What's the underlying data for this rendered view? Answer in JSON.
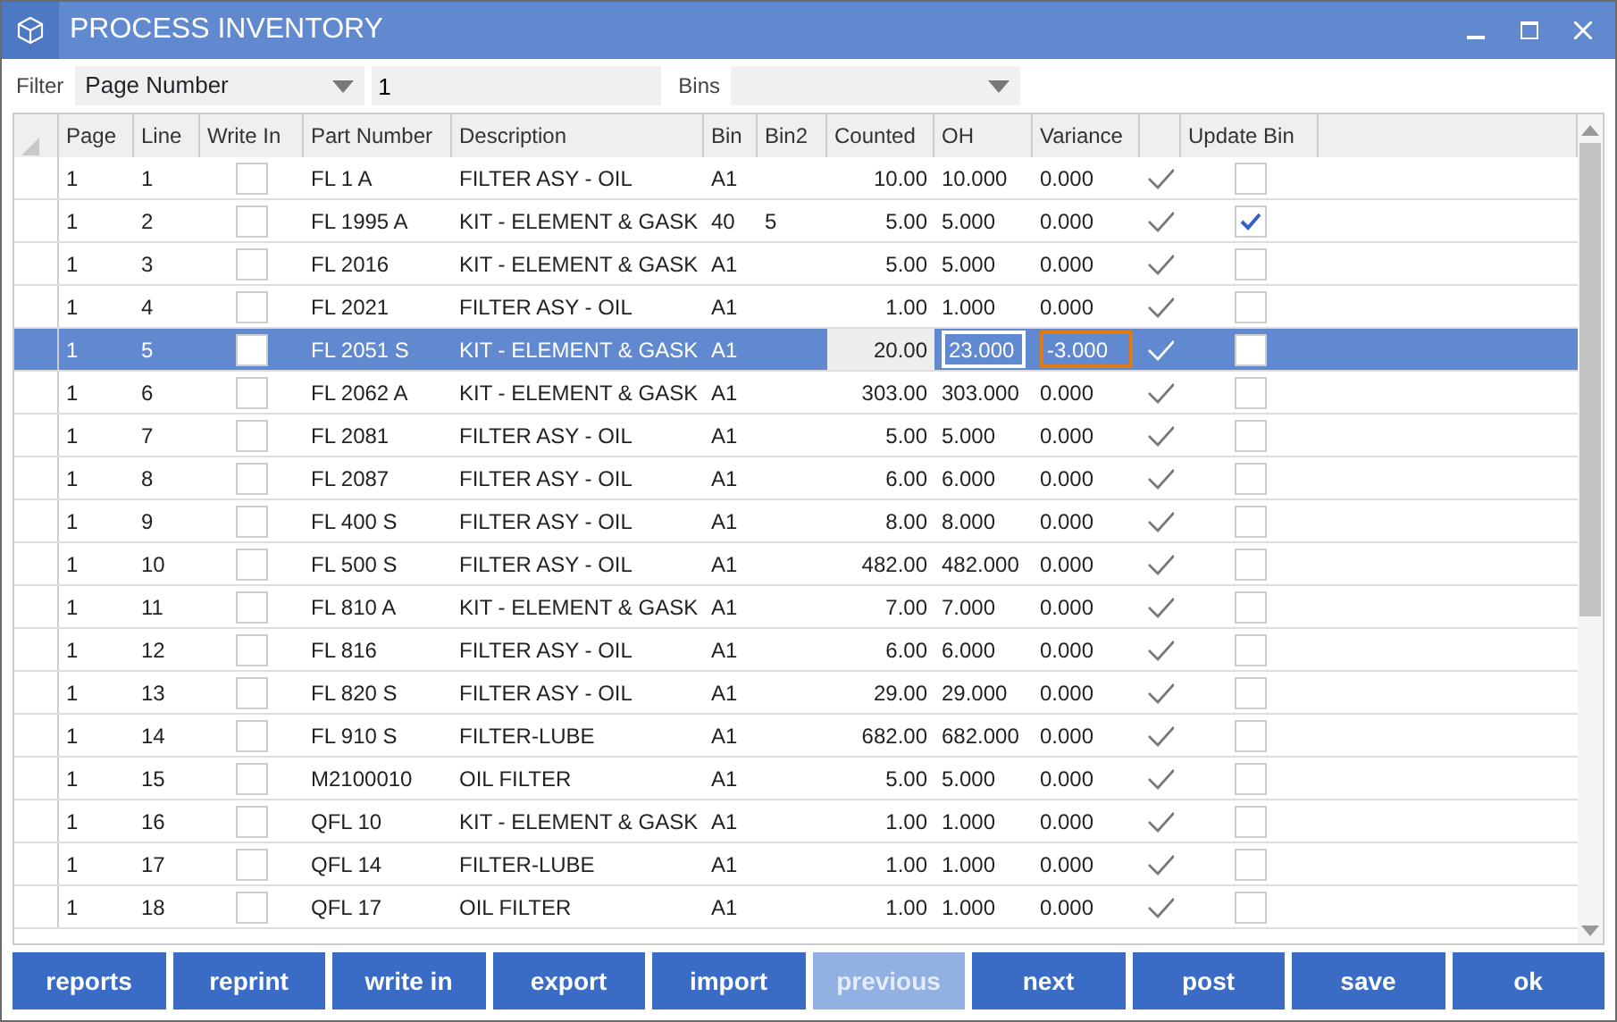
{
  "window": {
    "title": "PROCESS INVENTORY"
  },
  "filter": {
    "label": "Filter",
    "field": "Page Number",
    "value": "1",
    "bins_label": "Bins"
  },
  "table": {
    "columns": [
      "Page",
      "Line",
      "Write In",
      "Part Number",
      "Description",
      "Bin",
      "Bin2",
      "Counted",
      "OH",
      "Variance",
      "Update Bin"
    ],
    "rows": [
      {
        "page": "1",
        "line": "1",
        "write_in": false,
        "part": "FL 1 A",
        "description": "FILTER ASY - OIL",
        "bin": "A1",
        "counted": "10.00",
        "oh": "10.000",
        "variance": "0.000",
        "update_bin": false,
        "selected": false
      },
      {
        "page": "1",
        "line": "2",
        "write_in": false,
        "part": "FL 1995 A",
        "description": "KIT - ELEMENT & GASK",
        "bin": "40",
        "bin2": "5",
        "counted": "5.00",
        "oh": "5.000",
        "variance": "0.000",
        "update_bin": true,
        "selected": false
      },
      {
        "page": "1",
        "line": "3",
        "write_in": false,
        "part": "FL 2016",
        "description": "KIT - ELEMENT & GASK",
        "bin": "A1",
        "counted": "5.00",
        "oh": "5.000",
        "variance": "0.000",
        "update_bin": false,
        "selected": false
      },
      {
        "page": "1",
        "line": "4",
        "write_in": false,
        "part": "FL 2021",
        "description": "FILTER ASY - OIL",
        "bin": "A1",
        "counted": "1.00",
        "oh": "1.000",
        "variance": "0.000",
        "update_bin": false,
        "selected": false
      },
      {
        "page": "1",
        "line": "5",
        "write_in": false,
        "part": "FL 2051 S",
        "description": "KIT - ELEMENT & GASK",
        "bin": "A1",
        "counted": "20.00",
        "oh": "23.000",
        "variance": "-3.000",
        "update_bin": false,
        "selected": true
      },
      {
        "page": "1",
        "line": "6",
        "write_in": false,
        "part": "FL 2062 A",
        "description": "KIT - ELEMENT & GASK",
        "bin": "A1",
        "counted": "303.00",
        "oh": "303.000",
        "variance": "0.000",
        "update_bin": false,
        "selected": false
      },
      {
        "page": "1",
        "line": "7",
        "write_in": false,
        "part": "FL 2081",
        "description": "FILTER ASY - OIL",
        "bin": "A1",
        "counted": "5.00",
        "oh": "5.000",
        "variance": "0.000",
        "update_bin": false,
        "selected": false
      },
      {
        "page": "1",
        "line": "8",
        "write_in": false,
        "part": "FL 2087",
        "description": "FILTER ASY - OIL",
        "bin": "A1",
        "counted": "6.00",
        "oh": "6.000",
        "variance": "0.000",
        "update_bin": false,
        "selected": false
      },
      {
        "page": "1",
        "line": "9",
        "write_in": false,
        "part": "FL 400 S",
        "description": "FILTER ASY - OIL",
        "bin": "A1",
        "counted": "8.00",
        "oh": "8.000",
        "variance": "0.000",
        "update_bin": false,
        "selected": false
      },
      {
        "page": "1",
        "line": "10",
        "write_in": false,
        "part": "FL 500 S",
        "description": "FILTER ASY - OIL",
        "bin": "A1",
        "counted": "482.00",
        "oh": "482.000",
        "variance": "0.000",
        "update_bin": false,
        "selected": false
      },
      {
        "page": "1",
        "line": "11",
        "write_in": false,
        "part": "FL 810 A",
        "description": "KIT - ELEMENT & GASK",
        "bin": "A1",
        "counted": "7.00",
        "oh": "7.000",
        "variance": "0.000",
        "update_bin": false,
        "selected": false
      },
      {
        "page": "1",
        "line": "12",
        "write_in": false,
        "part": "FL 816",
        "description": "FILTER ASY - OIL",
        "bin": "A1",
        "counted": "6.00",
        "oh": "6.000",
        "variance": "0.000",
        "update_bin": false,
        "selected": false
      },
      {
        "page": "1",
        "line": "13",
        "write_in": false,
        "part": "FL 820 S",
        "description": "FILTER ASY - OIL",
        "bin": "A1",
        "counted": "29.00",
        "oh": "29.000",
        "variance": "0.000",
        "update_bin": false,
        "selected": false
      },
      {
        "page": "1",
        "line": "14",
        "write_in": false,
        "part": "FL 910 S",
        "description": "FILTER-LUBE",
        "bin": "A1",
        "counted": "682.00",
        "oh": "682.000",
        "variance": "0.000",
        "update_bin": false,
        "selected": false
      },
      {
        "page": "1",
        "line": "15",
        "write_in": false,
        "part": "M2100010",
        "description": "OIL FILTER",
        "bin": "A1",
        "counted": "5.00",
        "oh": "5.000",
        "variance": "0.000",
        "update_bin": false,
        "selected": false
      },
      {
        "page": "1",
        "line": "16",
        "write_in": false,
        "part": "QFL 10",
        "description": "KIT - ELEMENT & GASK",
        "bin": "A1",
        "counted": "1.00",
        "oh": "1.000",
        "variance": "0.000",
        "update_bin": false,
        "selected": false
      },
      {
        "page": "1",
        "line": "17",
        "write_in": false,
        "part": "QFL 14",
        "description": "FILTER-LUBE",
        "bin": "A1",
        "counted": "1.00",
        "oh": "1.000",
        "variance": "0.000",
        "update_bin": false,
        "selected": false
      },
      {
        "page": "1",
        "line": "18",
        "write_in": false,
        "part": "QFL 17",
        "description": "OIL FILTER",
        "bin": "A1",
        "counted": "1.00",
        "oh": "1.000",
        "variance": "0.000",
        "update_bin": false,
        "selected": false
      }
    ]
  },
  "buttons": [
    {
      "label": "reports",
      "disabled": false
    },
    {
      "label": "reprint",
      "disabled": false
    },
    {
      "label": "write in",
      "disabled": false
    },
    {
      "label": "export",
      "disabled": false
    },
    {
      "label": "import",
      "disabled": false
    },
    {
      "label": "previous",
      "disabled": true
    },
    {
      "label": "next",
      "disabled": false
    },
    {
      "label": "post",
      "disabled": false
    },
    {
      "label": "save",
      "disabled": false
    },
    {
      "label": "ok",
      "disabled": false
    }
  ]
}
